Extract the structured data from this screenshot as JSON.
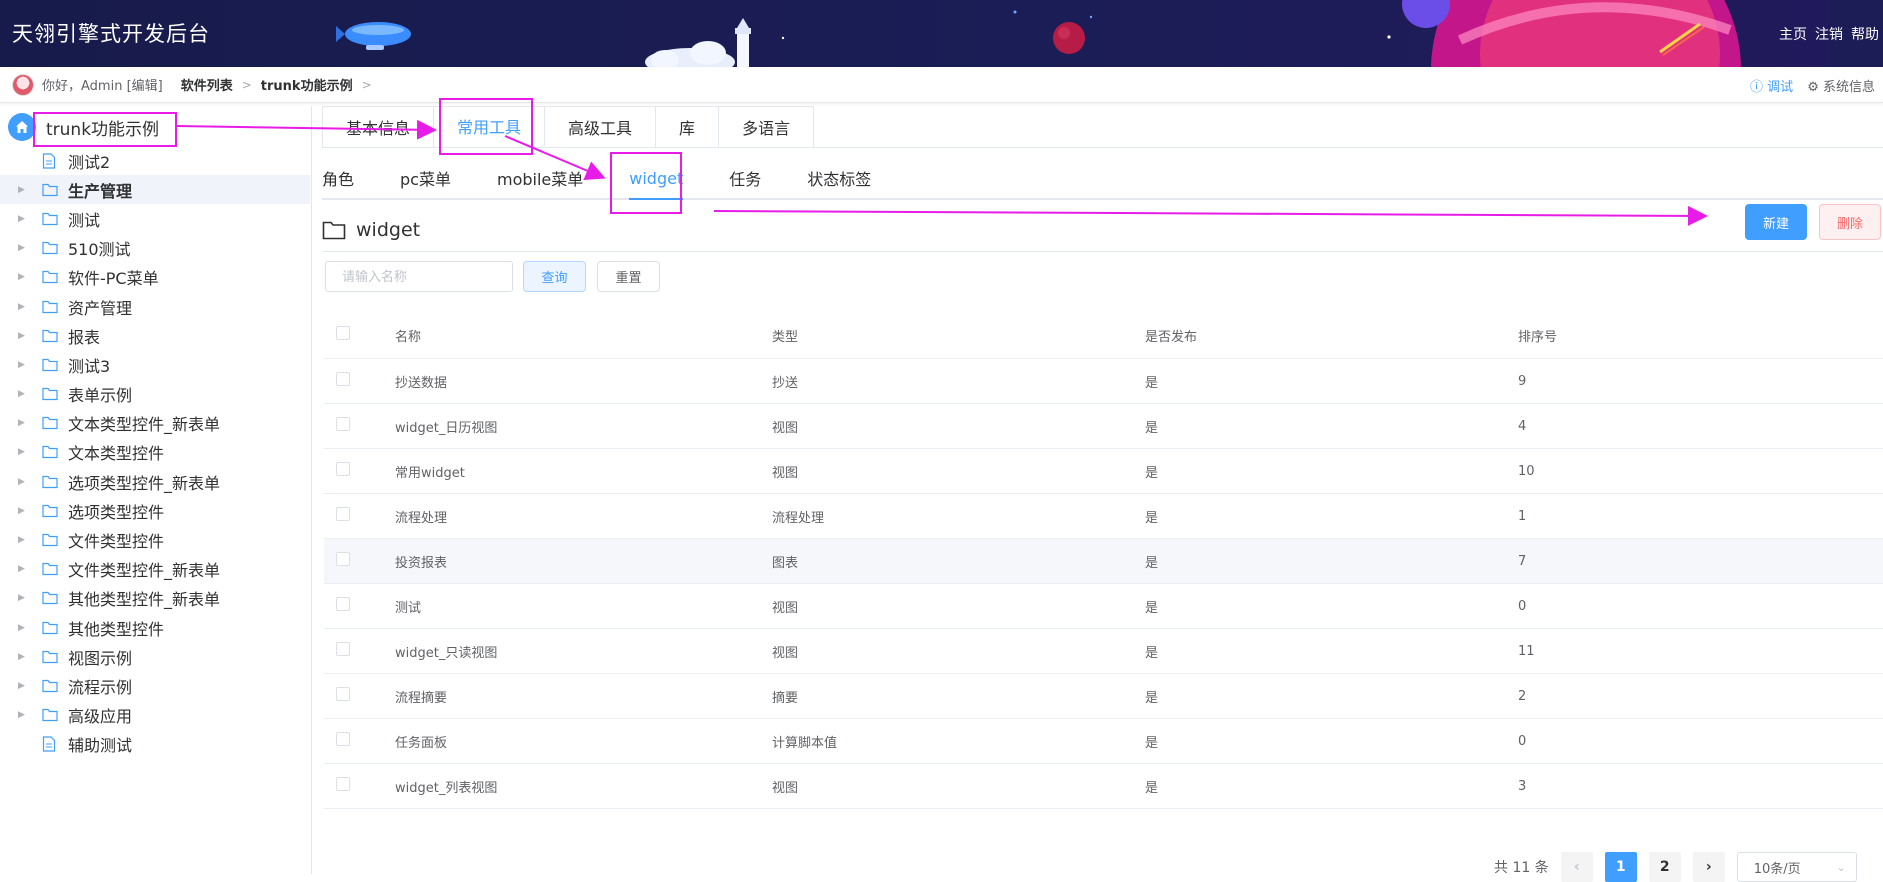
{
  "header": {
    "app_title": "天翎引擎式开发后台",
    "links": [
      "主页",
      "注销",
      "帮助"
    ]
  },
  "topbar": {
    "greeting": "你好，Admin [编辑]",
    "breadcrumbs": [
      "软件列表",
      "trunk功能示例"
    ],
    "debug_label": "调试",
    "system_label": "系统信息"
  },
  "sidebar": {
    "root_label": "trunk功能示例",
    "items": [
      {
        "label": "测试2",
        "icon": "document-icon",
        "expandable": false
      },
      {
        "label": "生产管理",
        "icon": "folder-icon",
        "expandable": true,
        "active": true
      },
      {
        "label": "测试",
        "icon": "folder-icon",
        "expandable": true
      },
      {
        "label": "510测试",
        "icon": "folder-icon",
        "expandable": true
      },
      {
        "label": "软件-PC菜单",
        "icon": "folder-icon",
        "expandable": true
      },
      {
        "label": "资产管理",
        "icon": "folder-icon",
        "expandable": true
      },
      {
        "label": "报表",
        "icon": "folder-icon",
        "expandable": true
      },
      {
        "label": "测试3",
        "icon": "folder-icon",
        "expandable": true
      },
      {
        "label": "表单示例",
        "icon": "folder-icon",
        "expandable": true
      },
      {
        "label": "文本类型控件_新表单",
        "icon": "folder-icon",
        "expandable": true
      },
      {
        "label": "文本类型控件",
        "icon": "folder-icon",
        "expandable": true
      },
      {
        "label": "选项类型控件_新表单",
        "icon": "folder-icon",
        "expandable": true
      },
      {
        "label": "选项类型控件",
        "icon": "folder-icon",
        "expandable": true
      },
      {
        "label": "文件类型控件",
        "icon": "folder-icon",
        "expandable": true
      },
      {
        "label": "文件类型控件_新表单",
        "icon": "folder-icon",
        "expandable": true
      },
      {
        "label": "其他类型控件_新表单",
        "icon": "folder-icon",
        "expandable": true
      },
      {
        "label": "其他类型控件",
        "icon": "folder-icon",
        "expandable": true
      },
      {
        "label": "视图示例",
        "icon": "folder-icon",
        "expandable": true
      },
      {
        "label": "流程示例",
        "icon": "folder-icon",
        "expandable": true
      },
      {
        "label": "高级应用",
        "icon": "folder-icon",
        "expandable": true
      },
      {
        "label": "辅助测试",
        "icon": "document-icon",
        "expandable": false
      }
    ]
  },
  "main": {
    "tabs": [
      "基本信息",
      "常用工具",
      "高级工具",
      "库",
      "多语言"
    ],
    "active_tab": "常用工具",
    "subtabs": [
      "角色",
      "pc菜单",
      "mobile菜单",
      "widget",
      "任务",
      "状态标签"
    ],
    "active_subtab": "widget",
    "folder_title": "widget",
    "new_button": "新建",
    "delete_button": "删除",
    "search": {
      "placeholder": "请输入名称",
      "value": ""
    },
    "query_button": "查询",
    "reset_button": "重置"
  },
  "table": {
    "columns": [
      "名称",
      "类型",
      "是否发布",
      "排序号"
    ],
    "rows": [
      [
        "抄送数据",
        "抄送",
        "是",
        "9"
      ],
      [
        "widget_日历视图",
        "视图",
        "是",
        "4"
      ],
      [
        "常用widget",
        "视图",
        "是",
        "10"
      ],
      [
        "流程处理",
        "流程处理",
        "是",
        "1"
      ],
      [
        "投资报表",
        "图表",
        "是",
        "7"
      ],
      [
        "测试",
        "视图",
        "是",
        "0"
      ],
      [
        "widget_只读视图",
        "视图",
        "是",
        "11"
      ],
      [
        "流程摘要",
        "摘要",
        "是",
        "2"
      ],
      [
        "任务面板",
        "计算脚本值",
        "是",
        "0"
      ],
      [
        "widget_列表视图",
        "视图",
        "是",
        "3"
      ]
    ],
    "hover_row_index": 4
  },
  "pagination": {
    "total_text": "共 11 条",
    "pages": [
      "1",
      "2"
    ],
    "current_page": "1",
    "prev_icon": "chevron-left-icon",
    "next_icon": "chevron-right-icon",
    "page_size": "10条/页"
  },
  "colors": {
    "primary": "#409eff",
    "danger": "#f56c6c",
    "header_bg": "#1b1d56",
    "annotation": "#e81ce8"
  }
}
